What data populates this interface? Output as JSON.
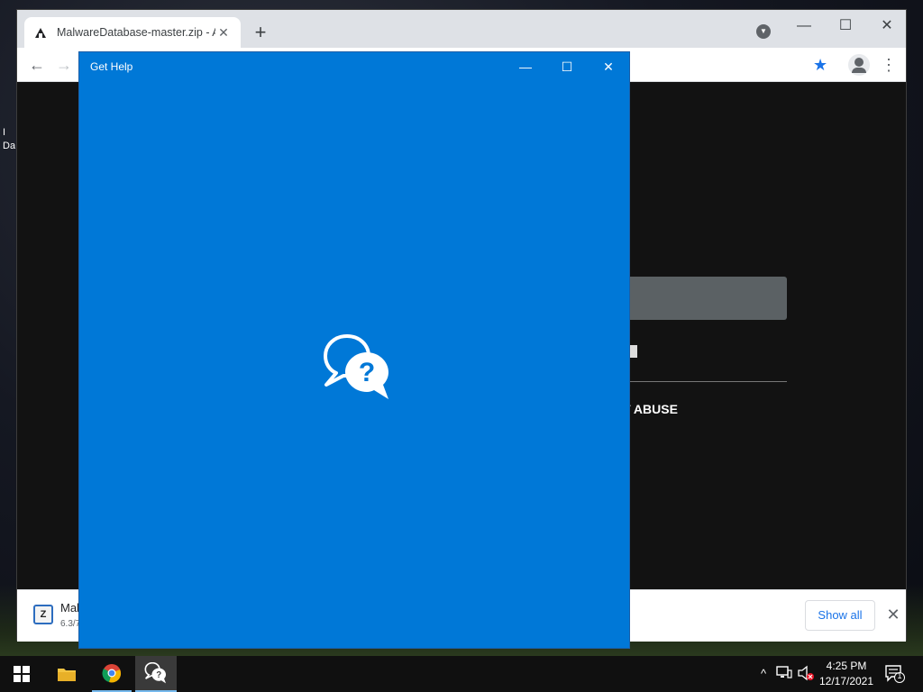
{
  "desktop": {
    "icon_label_fragment": "I Da"
  },
  "chrome": {
    "tab_title": "MalwareDatabase-master.zip - A",
    "tab_close": "✕",
    "new_tab": "+",
    "tab_search_icon": "chevron-down-icon",
    "minimize": "—",
    "maximize": "☐",
    "close": "✕",
    "back": "←",
    "forward": "→",
    "menu": "⋮",
    "star": "★"
  },
  "page": {
    "abuse_text": "T ABUSE"
  },
  "download_bar": {
    "file_name": "Mal",
    "file_size": "6.3/7",
    "icon_letter": "Z",
    "show_all": "Show all",
    "close": "✕"
  },
  "gethelp": {
    "title": "Get Help",
    "minimize": "—",
    "maximize": "☐",
    "close": "✕",
    "splash_icon": "chat-question-icon",
    "background": "#0078d7"
  },
  "taskbar": {
    "time": "4:25 PM",
    "date": "12/17/2021",
    "tray_up": "^",
    "notification_count": "1"
  }
}
